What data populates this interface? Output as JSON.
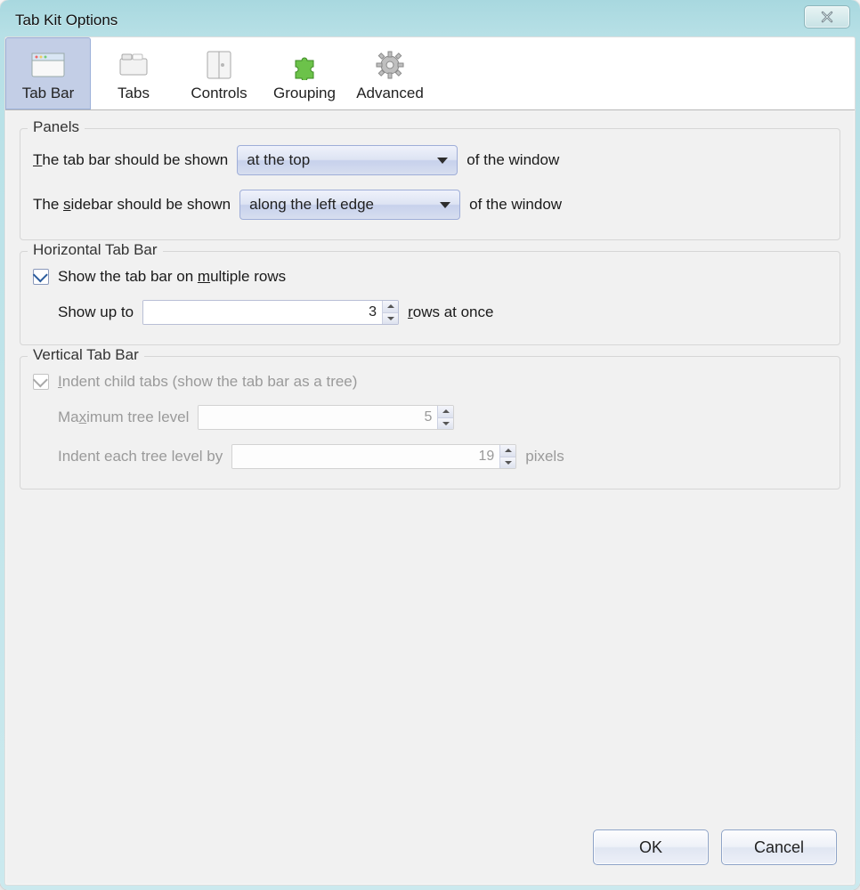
{
  "window": {
    "title": "Tab Kit Options"
  },
  "toolbar": {
    "items": [
      {
        "label": "Tab Bar"
      },
      {
        "label": "Tabs"
      },
      {
        "label": "Controls"
      },
      {
        "label": "Grouping"
      },
      {
        "label": "Advanced"
      }
    ]
  },
  "panels": {
    "title": "Panels",
    "tab_bar_label": "The tab bar should be shown",
    "tab_bar_value": "at the top",
    "sidebar_label": "The sidebar should be shown",
    "sidebar_value": "along the left edge",
    "suffix": "of the window"
  },
  "horizontal": {
    "title": "Horizontal Tab Bar",
    "multirow_label": "Show the tab bar on multiple rows",
    "multirow_checked": true,
    "showupto_prefix": "Show up to",
    "showupto_value": "3",
    "showupto_suffix": "rows at once"
  },
  "vertical": {
    "title": "Vertical Tab Bar",
    "indent_label": "Indent child tabs (show the tab bar as a tree)",
    "indent_checked": true,
    "disabled": true,
    "max_tree_label": "Maximum tree level",
    "max_tree_value": "5",
    "indent_by_label": "Indent each tree level by",
    "indent_by_value": "19",
    "indent_by_suffix": "pixels"
  },
  "footer": {
    "ok": "OK",
    "cancel": "Cancel"
  }
}
